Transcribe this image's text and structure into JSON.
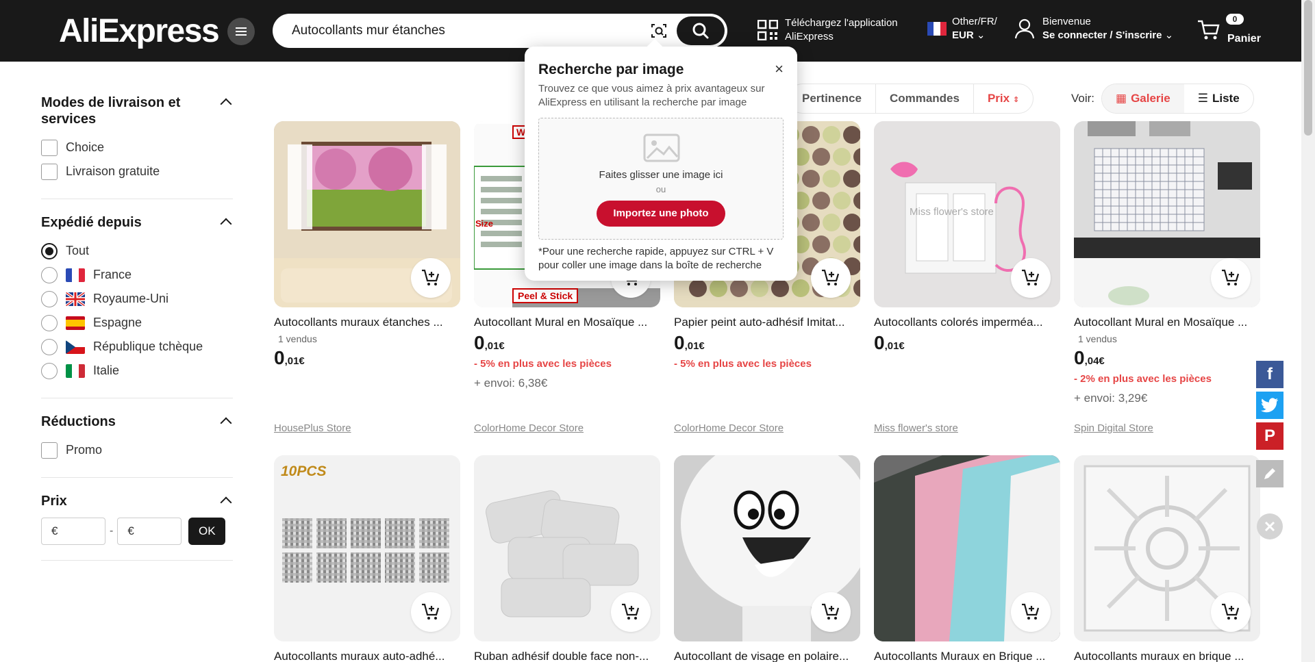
{
  "header": {
    "logo": "AliExpress",
    "search_value": "Autocollants mur étanches",
    "app_line1": "Téléchargez l'application",
    "app_line2": "AliExpress",
    "region_line1": "Other/FR/",
    "region_line2": "EUR",
    "welcome": "Bienvenue",
    "signin": "Se connecter / S'inscrire",
    "cart_count": "0",
    "cart_label": "Panier"
  },
  "sidebar": {
    "delivery_title": "Modes de livraison et services",
    "delivery_options": [
      "Choice",
      "Livraison gratuite"
    ],
    "shipfrom_title": "Expédié depuis",
    "shipfrom_options": [
      "Tout",
      "France",
      "Royaume-Uni",
      "Espagne",
      "République tchèque",
      "Italie"
    ],
    "discount_title": "Réductions",
    "discount_options": [
      "Promo"
    ],
    "price_title": "Prix",
    "price_min_placeholder": "€",
    "price_max_placeholder": "€",
    "price_sep": "-",
    "price_ok": "OK"
  },
  "sort": {
    "options": [
      "Pertinence",
      "Commandes",
      "Prix"
    ],
    "view_label": "Voir:",
    "gallery": "Galerie",
    "list": "Liste"
  },
  "popup": {
    "title": "Recherche par image",
    "desc": "Trouvez ce que vous aimez à prix avantageux sur AliExpress en utilisant la recherche par image",
    "drag": "Faites glisser une image ici",
    "or": "ou",
    "upload": "Importez une photo",
    "hint": "*Pour une recherche rapide, appuyez sur CTRL + V pour coller une image dans la boîte de recherche",
    "close": "×"
  },
  "products": [
    {
      "title": "Autocollants muraux étanches ...",
      "sold": "1 vendus",
      "price_int": "0",
      "price_dec": ",01€",
      "promo": "",
      "ship": "",
      "store": "HousePlus Store"
    },
    {
      "title": "Autocollant Mural en Mosaïque ...",
      "sold": "",
      "price_int": "0",
      "price_dec": ",01€",
      "promo": "- 5% en plus avec les pièces",
      "ship": "+ envoi: 6,38€",
      "store": "ColorHome Decor Store"
    },
    {
      "title": "Papier peint auto-adhésif Imitat...",
      "sold": "",
      "price_int": "0",
      "price_dec": ",01€",
      "promo": "- 5% en plus avec les pièces",
      "ship": "",
      "store": "ColorHome Decor Store"
    },
    {
      "title": "Autocollants colorés imperméa...",
      "sold": "",
      "price_int": "0",
      "price_dec": ",01€",
      "promo": "",
      "ship": "",
      "store": "Miss flower's store"
    },
    {
      "title": "Autocollant Mural en Mosaïque ...",
      "sold": "1 vendus",
      "price_int": "0",
      "price_dec": ",04€",
      "promo": "- 2% en plus avec les pièces",
      "ship": "+ envoi: 3,29€",
      "store": "Spin Digital Store"
    },
    {
      "title": "Autocollants muraux auto-adhé...",
      "sold": "",
      "price_int": "",
      "price_dec": "",
      "promo": "",
      "ship": "",
      "store": ""
    },
    {
      "title": "Ruban adhésif double face non-...",
      "sold": "",
      "price_int": "",
      "price_dec": "",
      "promo": "",
      "ship": "",
      "store": ""
    },
    {
      "title": "Autocollant de visage en polaire...",
      "sold": "",
      "price_int": "",
      "price_dec": "",
      "promo": "",
      "ship": "",
      "store": ""
    },
    {
      "title": "Autocollants Muraux en Brique ...",
      "sold": "",
      "price_int": "",
      "price_dec": "",
      "promo": "",
      "ship": "",
      "store": ""
    },
    {
      "title": "Autocollants muraux en brique ...",
      "sold": "",
      "price_int": "",
      "price_dec": "",
      "promo": "",
      "ship": "",
      "store": ""
    }
  ],
  "thumb_texts": {
    "p2_top": "Wa",
    "p2_size": "Size",
    "p2_label": "Peel & Stick",
    "p4_watermark": "Miss flower's store",
    "p6_label": "10PCS"
  },
  "social": [
    "f",
    "t",
    "P"
  ],
  "colors": {
    "header_bg": "#191919",
    "accent": "#e64545",
    "upload": "#c8102e",
    "facebook": "#3b5998",
    "twitter": "#1da1f2",
    "pinterest": "#cb2027"
  }
}
